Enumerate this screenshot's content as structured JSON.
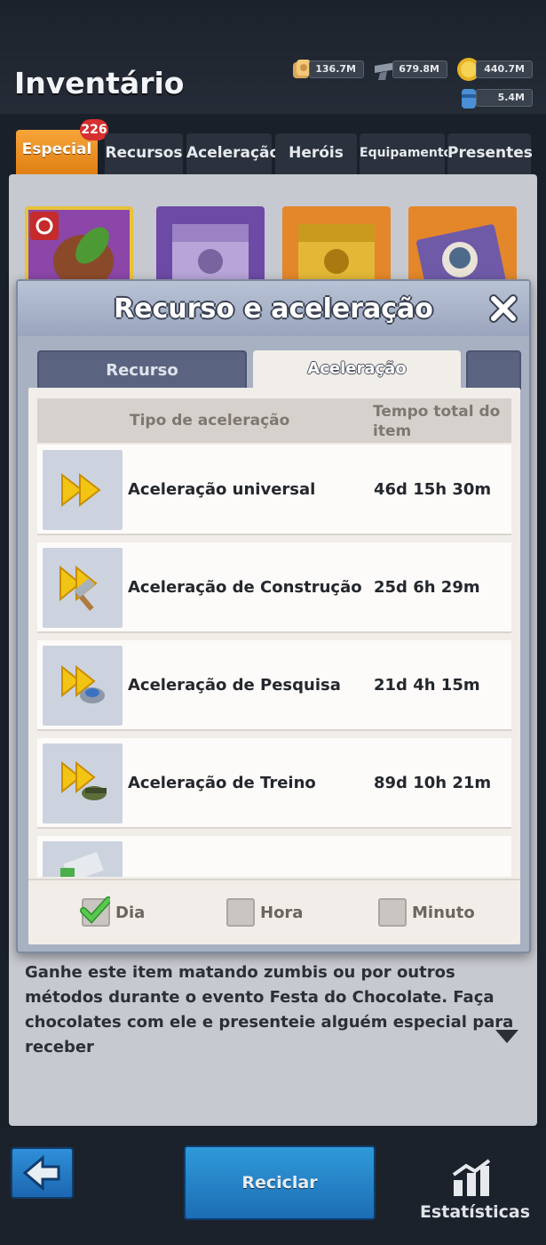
{
  "header": {
    "title": "Inventário",
    "resources": [
      {
        "icon": "wood-icon",
        "value": "136.7M"
      },
      {
        "icon": "steel-icon",
        "value": "679.8M"
      },
      {
        "icon": "gold-icon",
        "value": "440.7M"
      },
      {
        "icon": "oil-icon",
        "value": "5.4M"
      }
    ]
  },
  "category_tabs": [
    {
      "label": "Especial",
      "active": true,
      "badge": "226"
    },
    {
      "label": "Recursos"
    },
    {
      "label": "Aceleração"
    },
    {
      "label": "Heróis"
    },
    {
      "label": "Equipamento"
    },
    {
      "label": "Presentes"
    }
  ],
  "inventory": {
    "slots": [
      "cacao-item-icon",
      "purple-chest-icon",
      "gold-chest-icon",
      "hero-card-icon"
    ],
    "description": "Ganhe este item matando zumbis ou por outros métodos durante o evento Festa do Chocolate. Faça chocolates com ele e presenteie alguém especial para receber"
  },
  "modal": {
    "title": "Recurso e aceleração",
    "tabs": [
      {
        "label": "Recurso",
        "active": false
      },
      {
        "label": "Aceleração",
        "active": true
      }
    ],
    "columns": [
      "Tipo de aceleração",
      "Tempo total do item"
    ],
    "rows": [
      {
        "icon": "universal-speedup-icon",
        "name": "Aceleração universal",
        "time": "46d 15h 30m"
      },
      {
        "icon": "construction-speedup-icon",
        "name": "Aceleração de Construção",
        "time": "25d 6h 29m"
      },
      {
        "icon": "research-speedup-icon",
        "name": "Aceleração de Pesquisa",
        "time": "21d 4h 15m"
      },
      {
        "icon": "training-speedup-icon",
        "name": "Aceleração de Treino",
        "time": "89d 10h 21m"
      },
      {
        "icon": "healing-speedup-icon",
        "name": "",
        "time": ""
      }
    ],
    "units": [
      {
        "label": "Dia",
        "checked": true
      },
      {
        "label": "Hora",
        "checked": false
      },
      {
        "label": "Minuto",
        "checked": false
      }
    ]
  },
  "bottom": {
    "recycle": "Reciclar",
    "stats": "Estatísticas"
  },
  "colors": {
    "accent_orange": "#e98a1c",
    "button_blue": "#2a86cc",
    "check_green": "#3fae3a"
  }
}
